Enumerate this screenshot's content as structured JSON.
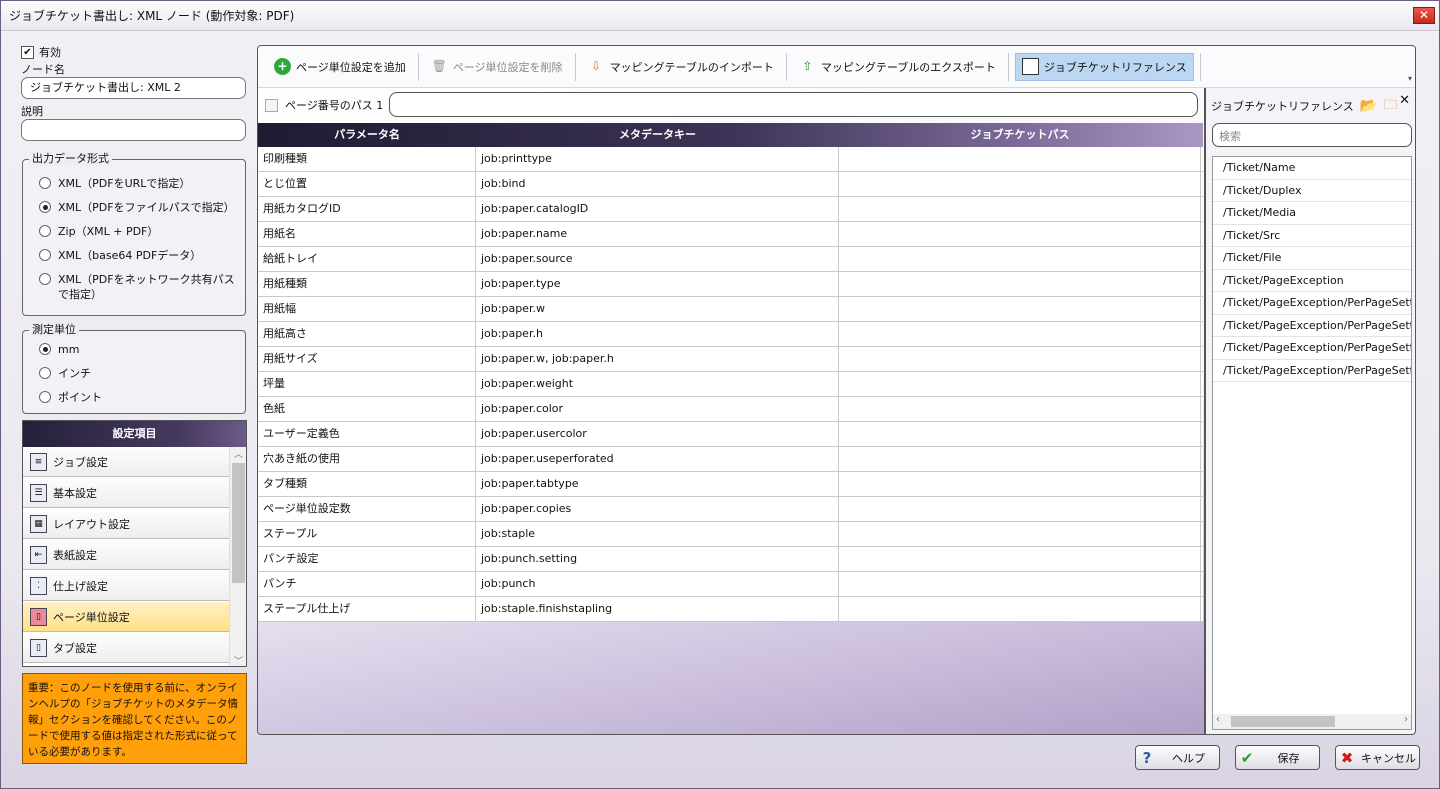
{
  "window": {
    "title": "ジョブチケット書出し: XML ノード (動作対象: PDF)",
    "close": "✕"
  },
  "left": {
    "enabled_label": "有効",
    "node_name_label": "ノード名",
    "node_name_value": "ジョブチケット書出し: XML 2",
    "description_label": "説明",
    "description_value": "",
    "output_format": {
      "title": "出力データ形式",
      "options": [
        "XML（PDFをURLで指定）",
        "XML（PDFをファイルパスで指定）",
        "Zip（XML + PDF）",
        "XML（base64 PDFデータ）",
        "XML（PDFをネットワーク共有パスで指定）"
      ],
      "selected": 1
    },
    "units": {
      "title": "測定単位",
      "options": [
        "mm",
        "インチ",
        "ポイント"
      ],
      "selected": 0
    },
    "settings": {
      "title": "設定項目",
      "items": [
        "ジョブ設定",
        "基本設定",
        "レイアウト設定",
        "表紙設定",
        "仕上げ設定",
        "ページ単位設定",
        "タブ設定"
      ],
      "selected": 5
    },
    "note": "重要：このノードを使用する前に、オンラインヘルプの「ジョブチケットのメタデータ情報」セクションを確認してください。このノードで使用する値は指定された形式に従っている必要があります。"
  },
  "toolbar": {
    "add": "ページ単位設定を追加",
    "delete": "ページ単位設定を削除",
    "import": "マッピングテーブルのインポート",
    "export": "マッピングテーブルのエクスポート",
    "reference": "ジョブチケットリファレンス"
  },
  "page_path_label": "ページ番号のパス 1",
  "page_path_value": "",
  "grid": {
    "headers": [
      "パラメータ名",
      "メタデータキー",
      "ジョブチケットパス"
    ],
    "rows": [
      [
        "印刷種類",
        "job:printtype",
        ""
      ],
      [
        "とじ位置",
        "job:bind",
        ""
      ],
      [
        "用紙カタログID",
        "job:paper.catalogID",
        ""
      ],
      [
        "用紙名",
        "job:paper.name",
        ""
      ],
      [
        "給紙トレイ",
        "job:paper.source",
        ""
      ],
      [
        "用紙種類",
        "job:paper.type",
        ""
      ],
      [
        "用紙幅",
        "job:paper.w",
        ""
      ],
      [
        "用紙高さ",
        "job:paper.h",
        ""
      ],
      [
        "用紙サイズ",
        "job:paper.w, job:paper.h",
        ""
      ],
      [
        "坪量",
        "job:paper.weight",
        ""
      ],
      [
        "色紙",
        "job:paper.color",
        ""
      ],
      [
        "ユーザー定義色",
        "job:paper.usercolor",
        ""
      ],
      [
        "穴あき紙の使用",
        "job:paper.useperforated",
        ""
      ],
      [
        "タブ種類",
        "job:paper.tabtype",
        ""
      ],
      [
        "ページ単位設定数",
        "job:paper.copies",
        ""
      ],
      [
        "ステープル",
        "job:staple",
        ""
      ],
      [
        "パンチ設定",
        "job:punch.setting",
        ""
      ],
      [
        "パンチ",
        "job:punch",
        ""
      ],
      [
        "ステープル仕上げ",
        "job:staple.finishstapling",
        ""
      ]
    ]
  },
  "reference": {
    "title": "ジョブチケットリファレンス",
    "search_placeholder": "検索",
    "items": [
      "/Ticket/Name",
      "/Ticket/Duplex",
      "/Ticket/Media",
      "/Ticket/Src",
      "/Ticket/File",
      "/Ticket/PageException",
      "/Ticket/PageException/PerPageSetting",
      "/Ticket/PageException/PerPageSetting",
      "/Ticket/PageException/PerPageSetting",
      "/Ticket/PageException/PerPageSetting"
    ]
  },
  "buttons": {
    "help": "ヘルプ",
    "save": "保存",
    "cancel": "キャンセル"
  }
}
